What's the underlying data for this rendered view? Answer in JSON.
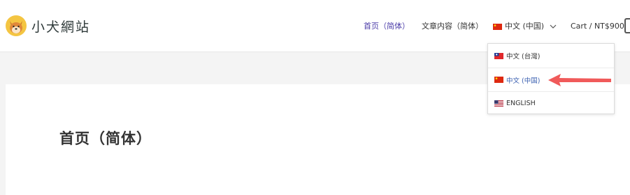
{
  "site": {
    "title": "小犬網站"
  },
  "nav": {
    "home": "首页（简体）",
    "articles": "文章内容（简体）",
    "language": "中文 (中国)",
    "cart": "Cart / NT$900"
  },
  "language_menu": {
    "items": [
      {
        "label": "中文 (台灣)",
        "flag": "taiwan-flag-icon"
      },
      {
        "label": "中文 (中国)",
        "flag": "china-flag-icon",
        "selected": true
      },
      {
        "label": "ENGLISH",
        "flag": "us-flag-icon"
      }
    ]
  },
  "page": {
    "title": "首页（简体）"
  },
  "colors": {
    "active_nav": "#4b3ca8",
    "selected_language": "#3a5fb0",
    "annotation_arrow": "#f05a5a",
    "page_background": "#f4f4f4"
  }
}
